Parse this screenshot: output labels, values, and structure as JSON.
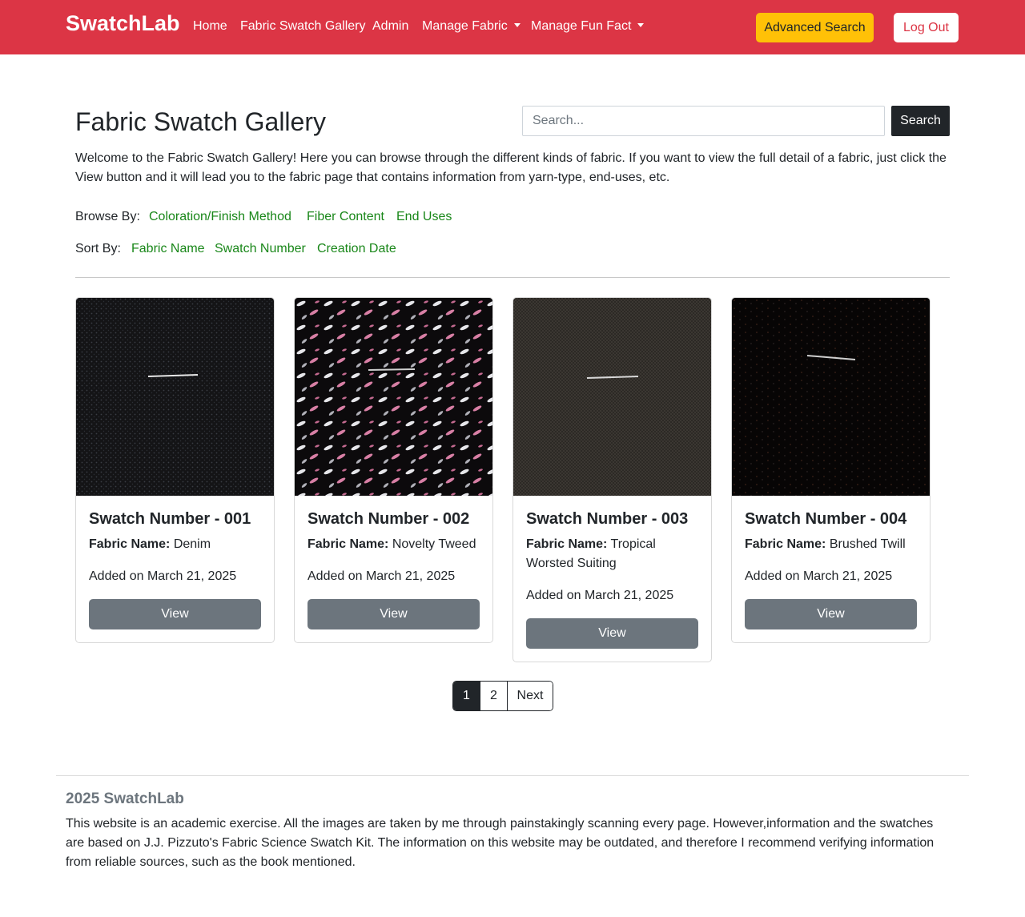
{
  "navbar": {
    "brand": "SwatchLab",
    "links": [
      "Home",
      "Fabric Swatch Gallery",
      "Admin"
    ],
    "dropdowns": [
      "Manage Fabric",
      "Manage Fun Fact"
    ],
    "advanced_search": "Advanced Search",
    "logout": "Log Out",
    "color": "#dc3545"
  },
  "header": {
    "title": "Fabric Swatch Gallery",
    "search_placeholder": "Search...",
    "search_button": "Search",
    "intro": "Welcome to the Fabric Swatch Gallery! Here you can browse through the different kinds of fabric. If you want to view the full detail of a fabric, just click the View button and it will lead you to the fabric page that contains information from yarn-type, end-uses, etc."
  },
  "browse": {
    "label": "Browse By:",
    "options": [
      "Coloration/Finish Method",
      "Fiber Content",
      "End Uses"
    ]
  },
  "sort": {
    "label": "Sort By:",
    "options": [
      "Fabric Name",
      "Swatch Number",
      "Creation Date"
    ]
  },
  "cards": [
    {
      "title": "Swatch Number - 001",
      "fabric_label": "Fabric Name:",
      "fabric_name": "Denim",
      "added": "Added on March 21, 2025",
      "button": "View"
    },
    {
      "title": "Swatch Number - 002",
      "fabric_label": "Fabric Name:",
      "fabric_name": "Novelty Tweed",
      "added": "Added on March 21, 2025",
      "button": "View"
    },
    {
      "title": "Swatch Number - 003",
      "fabric_label": "Fabric Name:",
      "fabric_name": "Tropical Worsted Suiting",
      "added": "Added on March 21, 2025",
      "button": "View"
    },
    {
      "title": "Swatch Number - 004",
      "fabric_label": "Fabric Name:",
      "fabric_name": "Brushed Twill",
      "added": "Added on March 21, 2025",
      "button": "View"
    }
  ],
  "pagination": {
    "pages": [
      "1",
      "2"
    ],
    "next": "Next",
    "current": "1"
  },
  "footer": {
    "title": "2025 SwatchLab",
    "text": "This website is an academic exercise. All the images are taken by me through painstakingly scanning every page. However,information and the swatches are based on J.J. Pizzuto's Fabric Science Swatch Kit. The information on this website may be outdated, and therefore I recommend verifying information from reliable sources, such as the book mentioned."
  }
}
